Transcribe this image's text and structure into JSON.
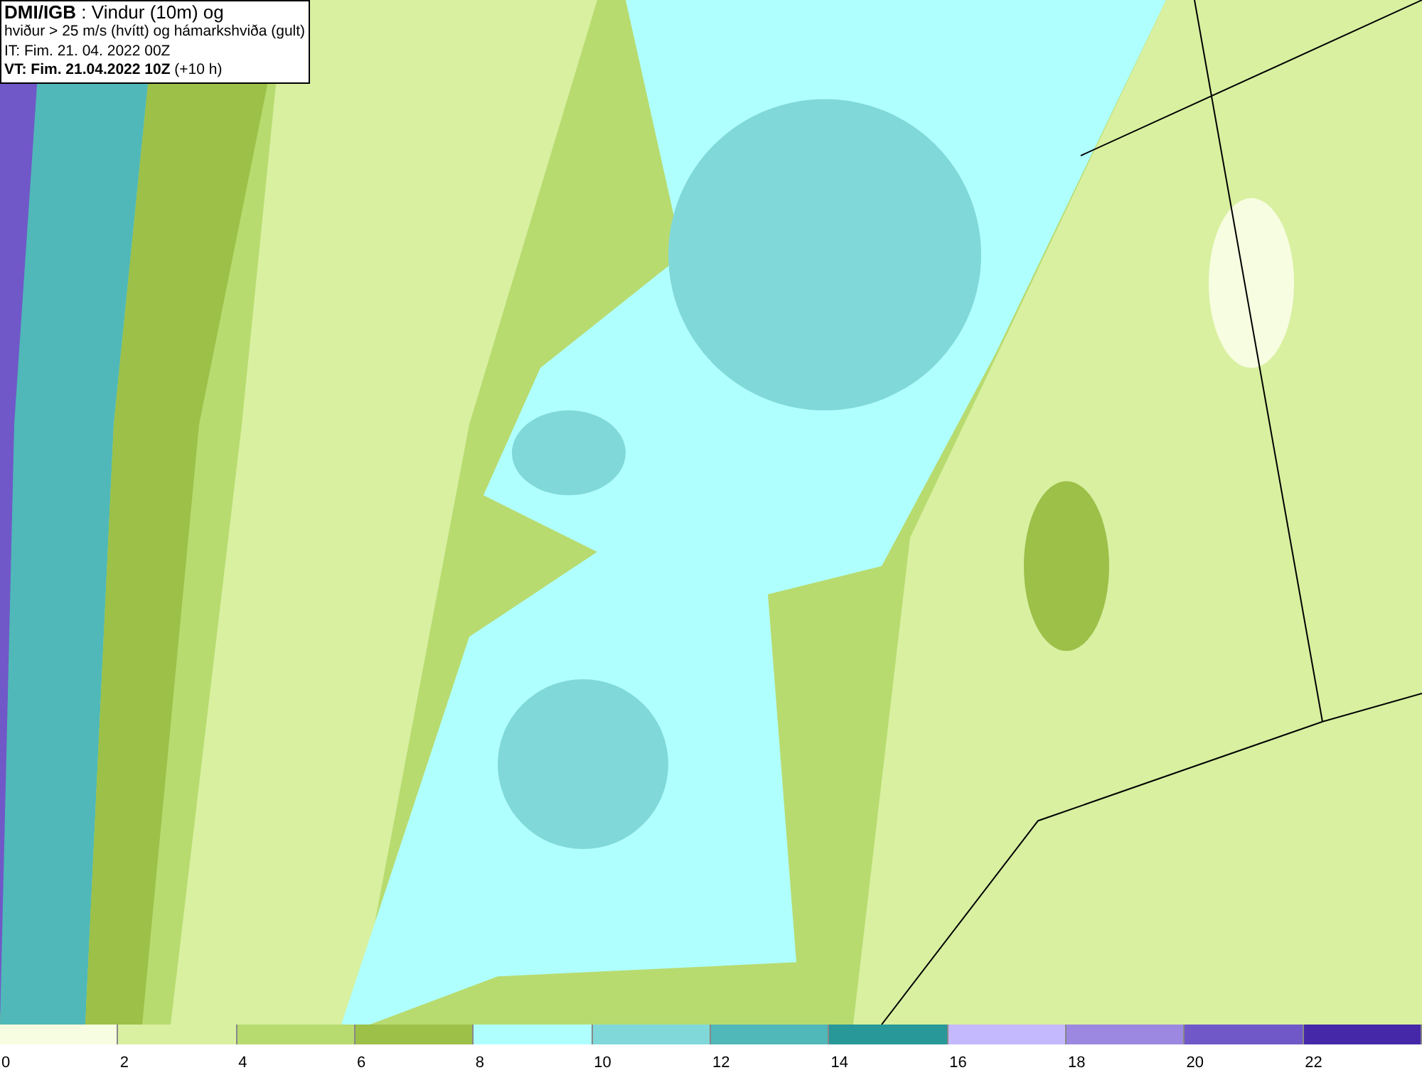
{
  "title_box": {
    "lines": [
      "**DMI/IGB** : Vindur (10m) og",
      "hviður > 25 m/s (hvítt) og hámarkshviða (gult)",
      "IT: Fim. 21. 04. 2022 00Z",
      "**VT: Fim. 21.04.2022 10Z** (+10 h)"
    ]
  },
  "legend": {
    "swatches": [
      {
        "color": "#f7fde0"
      },
      {
        "color": "#d8f0a0"
      },
      {
        "color": "#b8db70"
      },
      {
        "color": "#9cc048"
      },
      {
        "color": "#b0ffff"
      },
      {
        "color": "#80d8d8"
      },
      {
        "color": "#50b8b8"
      },
      {
        "color": "#289898"
      },
      {
        "color": "#c4b8ff"
      },
      {
        "color": "#9c88e0"
      },
      {
        "color": "#7058c8"
      },
      {
        "color": "#4428a8"
      }
    ],
    "ticks": [
      "0",
      "2",
      "4",
      "6",
      "8",
      "10",
      "12",
      "14",
      "16",
      "18",
      "20",
      "22"
    ]
  }
}
